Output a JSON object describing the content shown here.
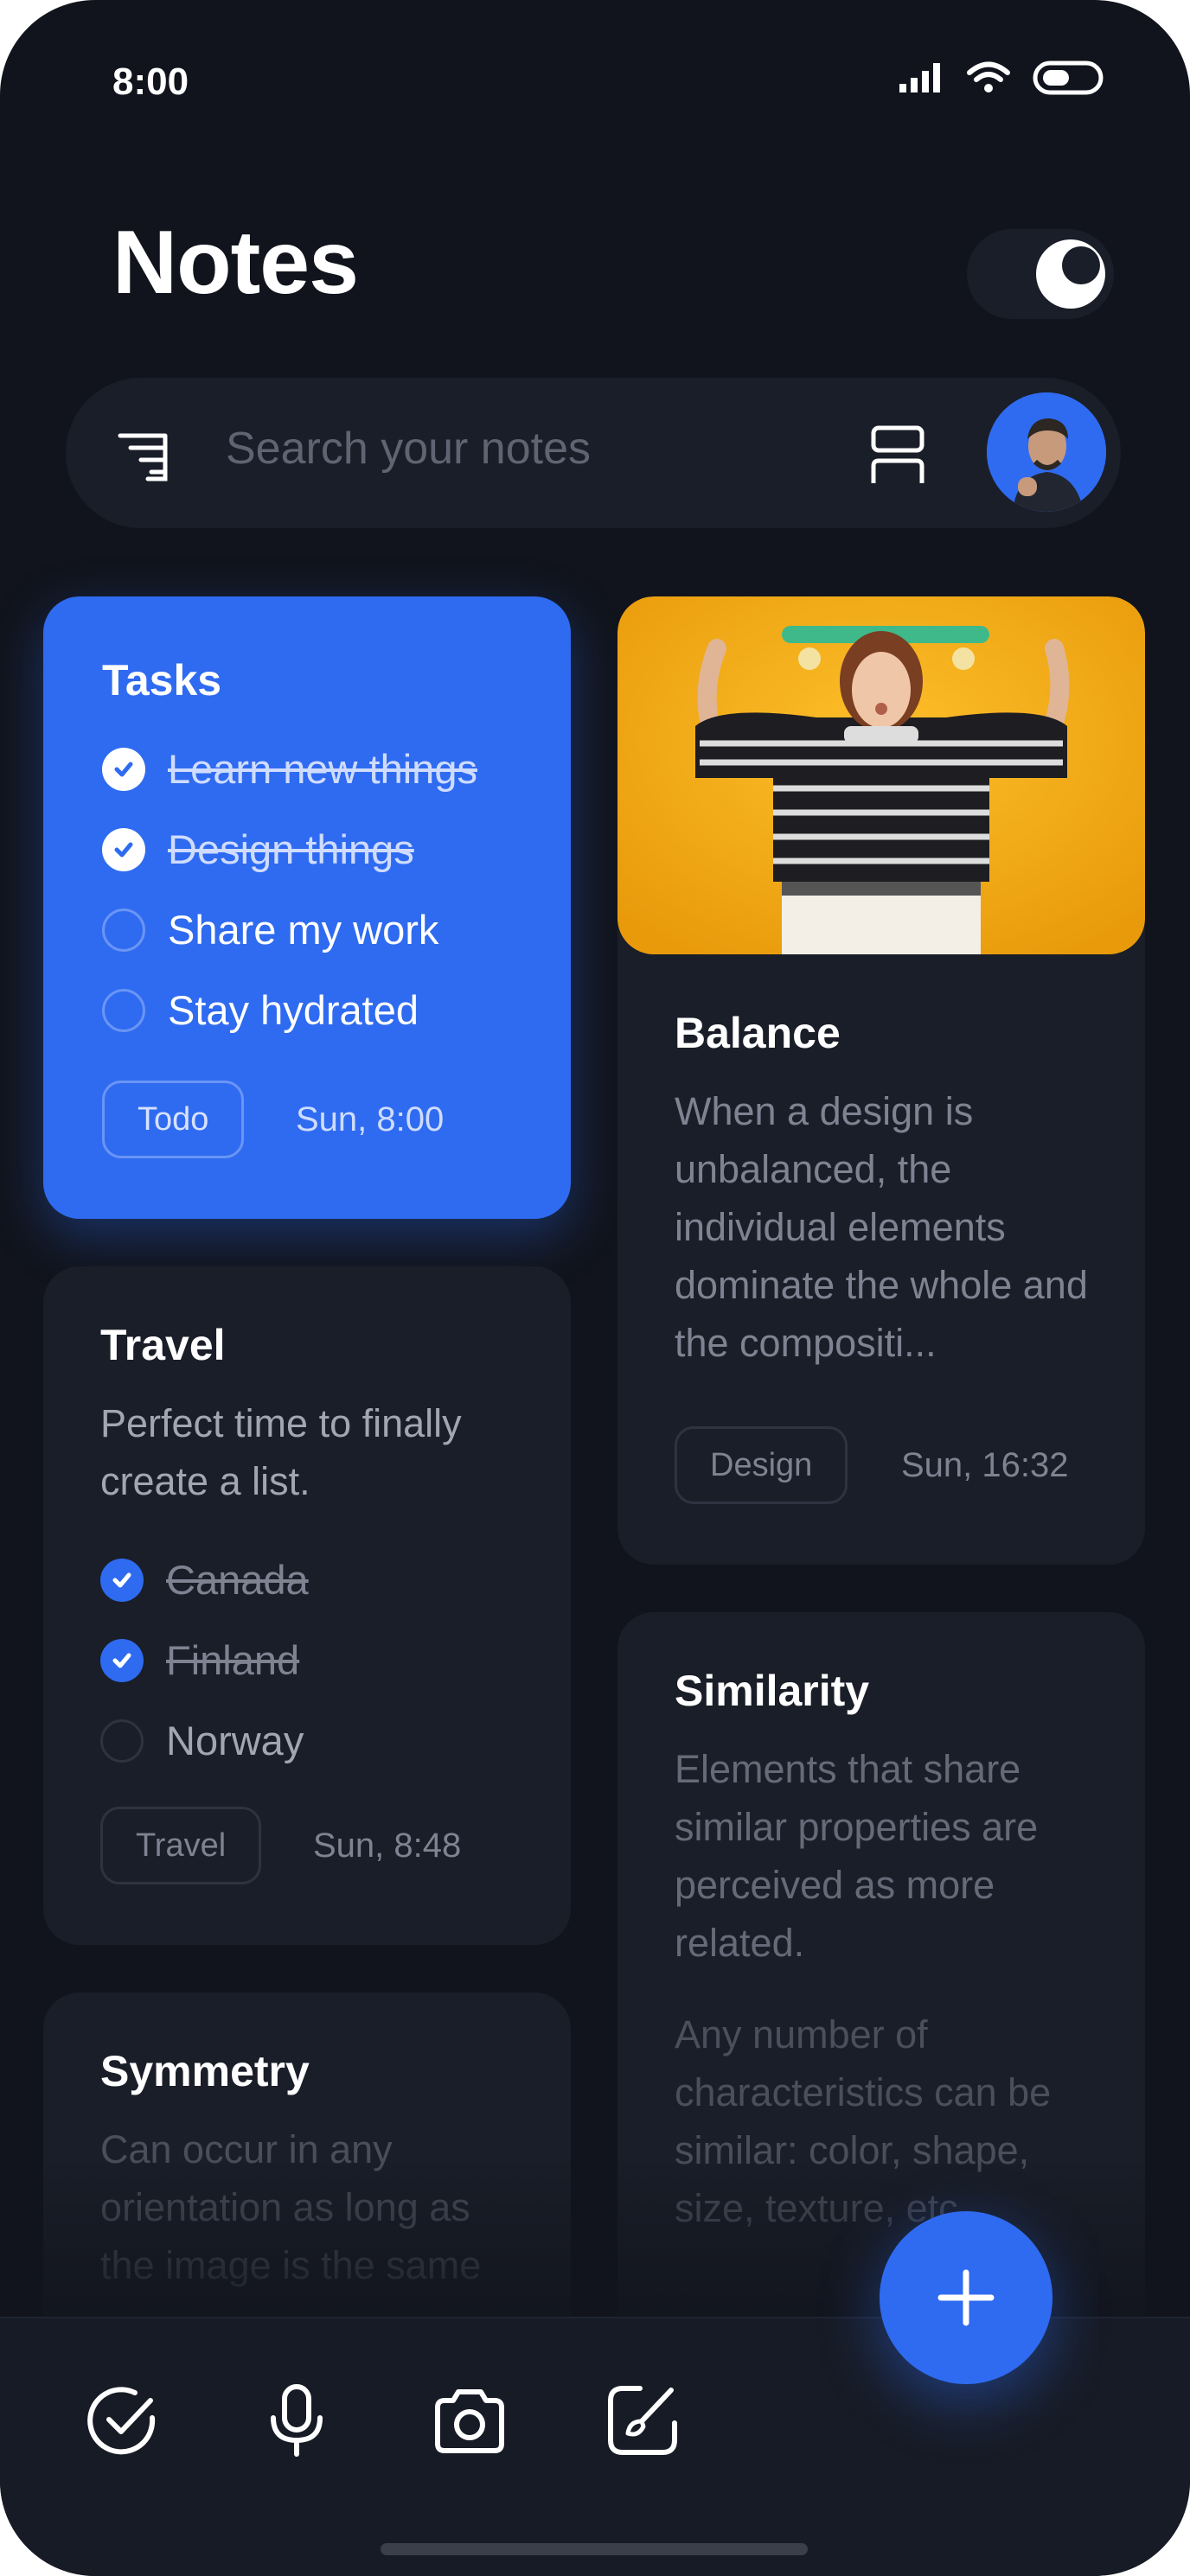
{
  "status": {
    "time": "8:00"
  },
  "header": {
    "title": "Notes"
  },
  "search": {
    "placeholder": "Search your notes"
  },
  "cards": {
    "tasks": {
      "title": "Tasks",
      "items": [
        {
          "label": "Learn new things",
          "done": true
        },
        {
          "label": "Design things",
          "done": true
        },
        {
          "label": "Share my work",
          "done": false
        },
        {
          "label": "Stay hydrated",
          "done": false
        }
      ],
      "tag": "Todo",
      "date": "Sun, 8:00"
    },
    "balance": {
      "title": "Balance",
      "text": "When a design is unbalanced, the individual elements dominate the whole and the compositi...",
      "tag": "Design",
      "date": "Sun, 16:32"
    },
    "travel": {
      "title": "Travel",
      "text": "Perfect time to finally create a list.",
      "items": [
        {
          "label": "Canada",
          "done": true
        },
        {
          "label": "Finland",
          "done": true
        },
        {
          "label": "Norway",
          "done": false
        }
      ],
      "tag": "Travel",
      "date": "Sun, 8:48"
    },
    "similarity": {
      "title": "Similarity",
      "text1": "Elements that share similar properties are perceived as more related.",
      "text2": "Any number of characteristics can be similar: color, shape, size, texture, etc."
    },
    "symmetry": {
      "title": "Symmetry",
      "text": "Can occur in any orientation as long as the image is the same"
    }
  },
  "colors": {
    "accent": "#2f6bf0",
    "background": "#11141c",
    "card": "#1a1e28"
  },
  "bottom_bar": {
    "icons": [
      "checklist-icon",
      "microphone-icon",
      "camera-icon",
      "drawing-icon"
    ]
  }
}
